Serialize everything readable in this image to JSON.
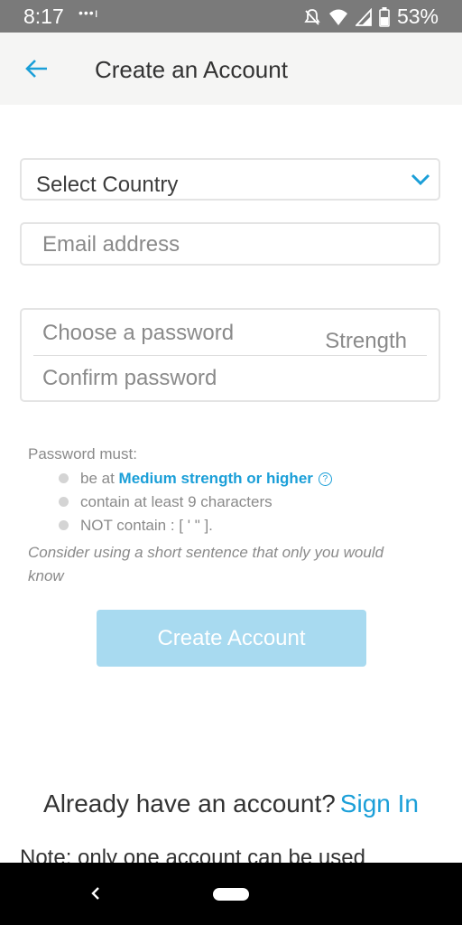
{
  "status_bar": {
    "time": "8:17",
    "battery": "53%",
    "dots": "•••ı"
  },
  "header": {
    "title": "Create an Account"
  },
  "form": {
    "country_label": "Select Country",
    "email_placeholder": "Email address",
    "password_placeholder": "Choose a password",
    "strength_label": "Strength",
    "confirm_placeholder": "Confirm password"
  },
  "rules": {
    "title": "Password must:",
    "items": [
      {
        "prefix": "be at ",
        "highlight": "Medium strength or higher"
      },
      {
        "text": "contain at least 9 characters"
      },
      {
        "text": "NOT contain : [ ' \" ]."
      }
    ],
    "help_icon_text": "?",
    "tip": "Consider using a short sentence that only you would know"
  },
  "actions": {
    "create_label": "Create Account"
  },
  "footer": {
    "signin_prompt": "Already have an account?",
    "signin_link": "Sign In",
    "note": "Note: only one account can be used"
  },
  "colors": {
    "accent": "#1b9fd8",
    "button_disabled": "#a8daf0",
    "header_bg": "#f5f5f4"
  },
  "icons": {
    "back": "arrow-left-icon",
    "dropdown": "chevron-down-icon",
    "help": "question-circle-icon"
  }
}
